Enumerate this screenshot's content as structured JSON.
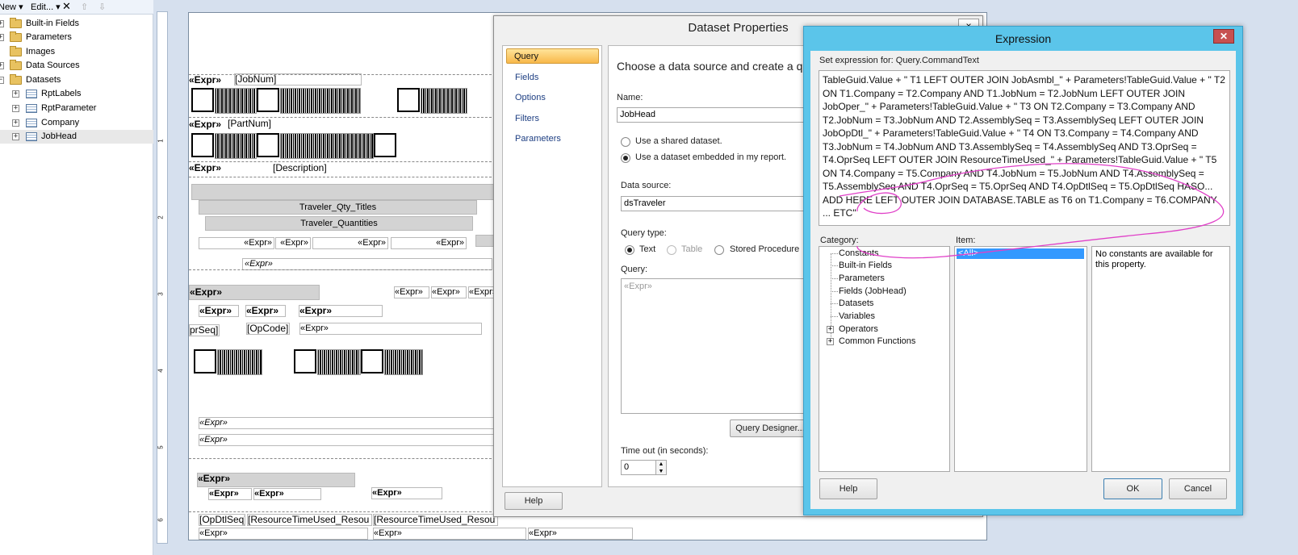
{
  "left_panel": {
    "toolbar": {
      "new_label": "New",
      "edit_label": "Edit...",
      "delete_icon": "close-icon",
      "up_icon": "arrow-up-icon",
      "down_icon": "arrow-down-icon"
    },
    "tree": [
      {
        "label": "Built-in Fields",
        "icon": "folder-icon",
        "expander": "+"
      },
      {
        "label": "Parameters",
        "icon": "folder-icon",
        "expander": "+"
      },
      {
        "label": "Images",
        "icon": "folder-icon",
        "expander": ""
      },
      {
        "label": "Data Sources",
        "icon": "folder-icon",
        "expander": "+"
      },
      {
        "label": "Datasets",
        "icon": "folder-icon",
        "expander": "−"
      },
      {
        "label": "RptLabels",
        "icon": "dataset-icon",
        "expander": "+"
      },
      {
        "label": "RptParameter",
        "icon": "dataset-icon",
        "expander": "+"
      },
      {
        "label": "Company",
        "icon": "dataset-icon",
        "expander": "+"
      },
      {
        "label": "JobHead",
        "icon": "dataset-icon",
        "expander": "+"
      }
    ]
  },
  "ruler": {
    "numbers": [
      "1",
      "2",
      "3",
      "4",
      "5",
      "6"
    ]
  },
  "report": {
    "expr": "«Expr»",
    "jobnum": "[JobNum]",
    "partnum": "[PartNum]",
    "description": "[Description]",
    "qty_titles": "Traveler_Qty_Titles",
    "quantities": "Traveler_Quantities",
    "oprseq": "prSeq]",
    "opcode": "[OpCode]",
    "opdtlseq": "[OpDtlSeq]",
    "resource1": "[ResourceTimeUsed_Resou",
    "resource2": "[ResourceTimeUsed_Resou"
  },
  "dataset_dialog": {
    "title": "Dataset Properties",
    "close": "×",
    "nav": [
      "Query",
      "Fields",
      "Options",
      "Filters",
      "Parameters"
    ],
    "heading": "Choose a data source and create a que",
    "name_label": "Name:",
    "name_value": "JobHead",
    "radio_shared": "Use a shared dataset.",
    "radio_embedded": "Use a dataset embedded in my report.",
    "datasource_label": "Data source:",
    "datasource_value": "dsTraveler",
    "querytype_label": "Query type:",
    "qt_text": "Text",
    "qt_table": "Table",
    "qt_stored": "Stored Procedure",
    "query_label": "Query:",
    "query_value": "«Expr»",
    "query_designer": "Query Designer...",
    "timeout_label": "Time out (in seconds):",
    "timeout_value": "0",
    "help": "Help"
  },
  "expression_dialog": {
    "title": "Expression",
    "close": "✕",
    "set_label": "Set expression for: Query.CommandText",
    "expression": "TableGuid.Value + \" T1 LEFT OUTER JOIN JobAsmbl_\" + Parameters!TableGuid.Value + \" T2  ON T1.Company = T2.Company AND T1.JobNum = T2.JobNum LEFT OUTER JOIN JobOper_\" + Parameters!TableGuid.Value + \" T3  ON T2.Company = T3.Company AND T2.JobNum = T3.JobNum AND T2.AssemblySeq = T3.AssemblySeq LEFT OUTER JOIN JobOpDtl_\" + Parameters!TableGuid.Value + \" T4  ON T3.Company = T4.Company AND T3.JobNum = T4.JobNum AND T3.AssemblySeq = T4.AssemblySeq AND T3.OprSeq = T4.OprSeq LEFT OUTER JOIN ResourceTimeUsed_\" + Parameters!TableGuid.Value + \" T5  ON T4.Company = T5.Company AND T4.JobNum = T5.JobNum AND T4.AssemblySeq = T5.AssemblySeq AND T4.OprSeq = T5.OprSeq AND T4.OpDtlSeq = T5.OpDtlSeq HASO... ADD HERE LEFT OUTER JOIN DATABASE.TABLE as T6 on T1.Company = T6.COMPANY ... ETC\"",
    "category_label": "Category:",
    "item_label": "Item:",
    "categories": [
      "Constants",
      "Built-in Fields",
      "Parameters",
      "Fields (JobHead)",
      "Datasets",
      "Variables",
      "Operators",
      "Common Functions"
    ],
    "item_selected": "<All>",
    "description": "No constants are available for this property.",
    "help": "Help",
    "ok": "OK",
    "cancel": "Cancel"
  },
  "colors": {
    "title_bar": "#5bc5ea",
    "close_button": "#c75050",
    "annotation": "#e040c8",
    "selection": "#3399ff",
    "nav_selected": "#f8b84a"
  }
}
